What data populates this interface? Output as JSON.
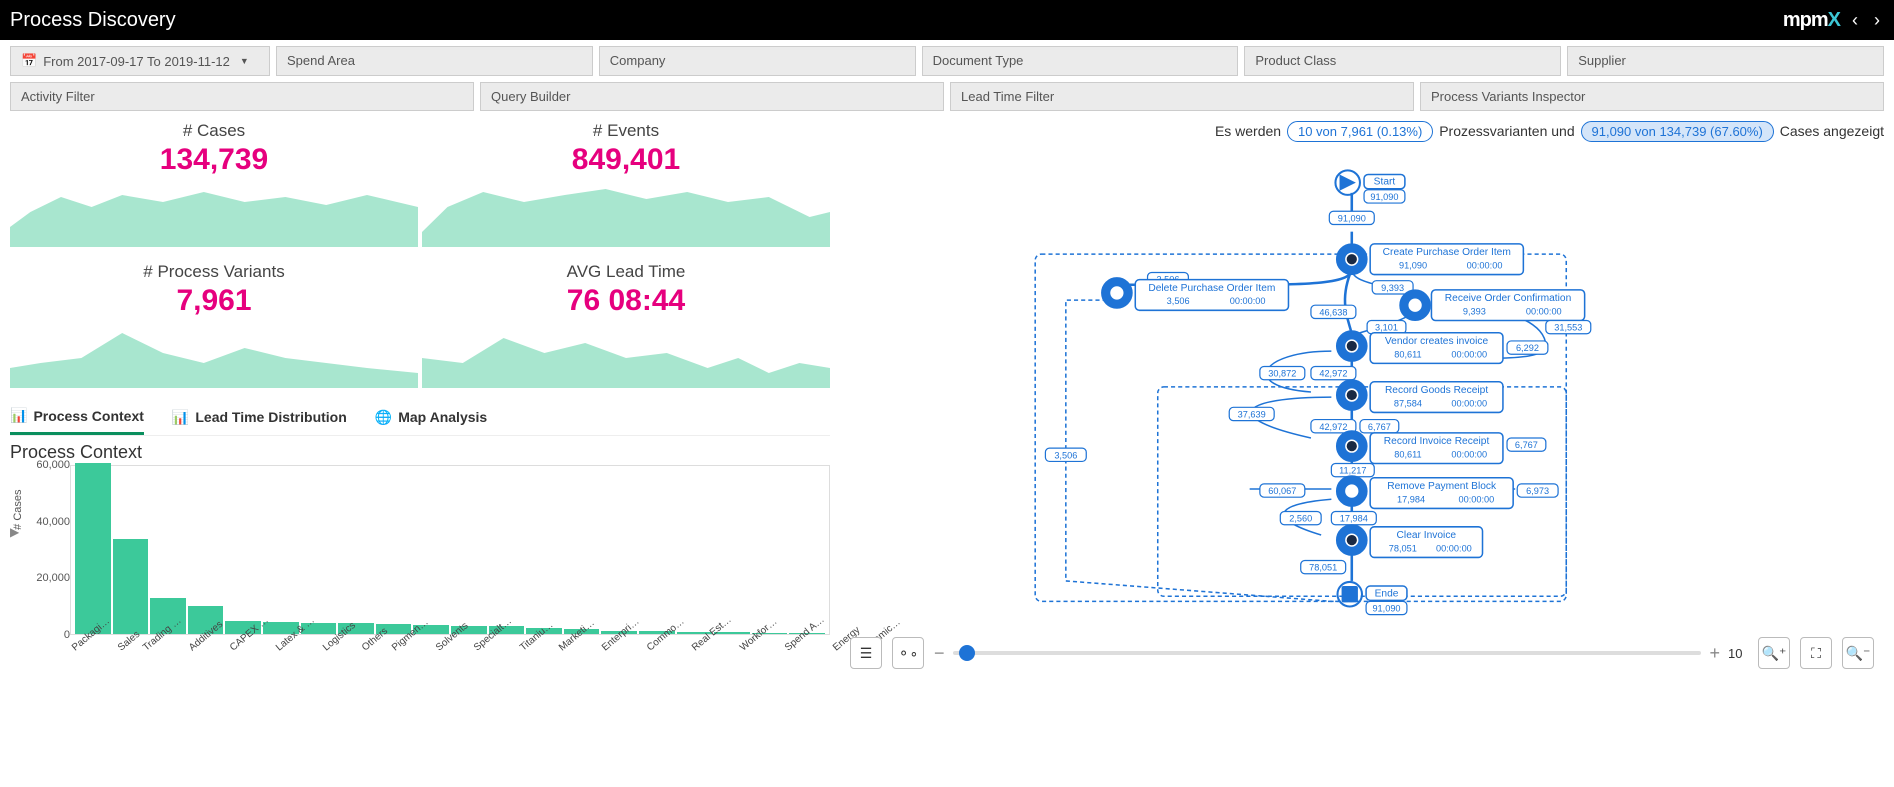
{
  "header": {
    "title": "Process Discovery",
    "logo": "mpmX"
  },
  "date_filter": {
    "prefix": "From",
    "label": "From 2017-09-17 To 2019-11-12"
  },
  "filters_top": [
    "Spend Area",
    "Company",
    "Document Type",
    "Product Class",
    "Supplier"
  ],
  "filters_bottom": [
    "Activity Filter",
    "Query Builder",
    "Lead Time Filter",
    "Process Variants Inspector"
  ],
  "kpis": {
    "cases": {
      "title": "# Cases",
      "value": "134,739"
    },
    "events": {
      "title": "# Events",
      "value": "849,401"
    },
    "variants": {
      "title": "# Process Variants",
      "value": "7,961"
    },
    "leadtime": {
      "title": "AVG Lead Time",
      "value": "76 08:44"
    }
  },
  "tabs": {
    "t0": "Process Context",
    "t1": "Lead Time Distribution",
    "t2": "Map Analysis"
  },
  "chart_title": "Process Context",
  "chart_data": {
    "type": "bar",
    "ylabel": "# Cases",
    "ylim": [
      0,
      60000
    ],
    "yticks": [
      0,
      20000,
      40000,
      60000
    ],
    "ytick_labels": [
      "0",
      "20,000",
      "40,000",
      "60,000"
    ],
    "categories": [
      "Packagi…",
      "Sales",
      "Trading …",
      "Additives",
      "CAPEX …",
      "Latex & …",
      "Logistics",
      "Others",
      "Pigmen…",
      "Solvents",
      "Specialt…",
      "Titaniu…",
      "Marketi…",
      "Enterpri…",
      "Commo…",
      "Real Est…",
      "Workfor…",
      "Spend A…",
      "Energy",
      "Chemic…"
    ],
    "values": [
      61000,
      34000,
      13000,
      10000,
      4500,
      4200,
      4000,
      3800,
      3500,
      3200,
      3000,
      2800,
      2000,
      1800,
      1200,
      1000,
      800,
      600,
      500,
      400
    ]
  },
  "variants_info": {
    "pre": "Es werden",
    "pill1": "10 von 7,961 (0.13%)",
    "mid": "Prozessvarianten und",
    "pill2": "91,090 von 134,739 (67.60%)",
    "post": "Cases angezeigt"
  },
  "process_map": {
    "start": {
      "label": "Start",
      "count": "91,090"
    },
    "end": {
      "label": "Ende",
      "count": "91,090"
    },
    "nodes": {
      "n0": {
        "label": "Create Purchase Order Item",
        "count": "91,090",
        "time": "00:00:00"
      },
      "n1": {
        "label": "Delete Purchase Order Item",
        "count": "3,506",
        "time": "00:00:00"
      },
      "n2": {
        "label": "Receive Order Confirmation",
        "count": "9,393",
        "time": "00:00:00"
      },
      "n3": {
        "label": "Vendor creates invoice",
        "count": "80,611",
        "time": "00:00:00"
      },
      "n4": {
        "label": "Record Goods Receipt",
        "count": "87,584",
        "time": "00:00:00"
      },
      "n5": {
        "label": "Record Invoice Receipt",
        "count": "80,611",
        "time": "00:00:00"
      },
      "n6": {
        "label": "Remove Payment Block",
        "count": "17,984",
        "time": "00:00:00"
      },
      "n7": {
        "label": "Clear Invoice",
        "count": "78,051",
        "time": "00:00:00"
      }
    },
    "edges": {
      "e_start_n0": "91,090",
      "e_n0_n1": "3,506",
      "e_n0_n2": "9,393",
      "e_n0_n3": "46,638",
      "e_n2_n3": "3,101",
      "e_n2_loop": "31,553",
      "e_n3_n4": "42,972",
      "e_n3_side": "30,872",
      "e_n3_right": "6,292",
      "e_n4_n5a": "42,972",
      "e_n4_n5b": "6,767",
      "e_n4_left": "37,639",
      "e_n5_right": "6,767",
      "e_n5_n6": "11,217",
      "e_n6_left": "60,067",
      "e_n6_right": "6,973",
      "e_n6_n7": "17,984",
      "e_n6_side": "2,560",
      "e_n7_end": "78,051",
      "e_n1_end": "3,506"
    }
  },
  "slider_value": "10"
}
